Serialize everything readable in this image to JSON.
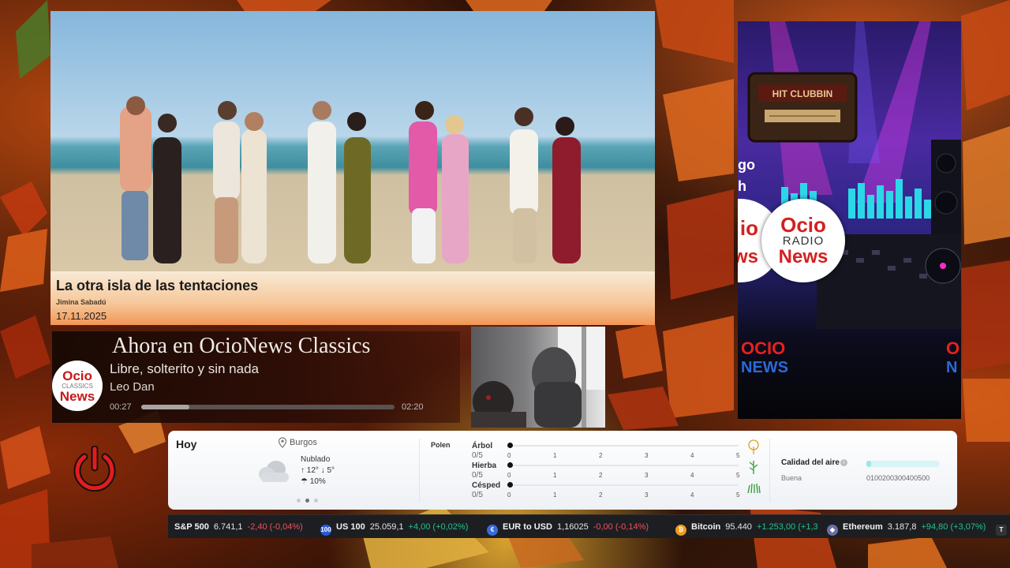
{
  "news": {
    "title": "La otra isla de las tentaciones",
    "author": "Jimina Sabadú",
    "date": "17.11.2025"
  },
  "radio": {
    "side_text_1": "go",
    "side_text_2": "h",
    "logo_top": "Ocio",
    "logo_mid": "RADIO",
    "logo_bottom": "News",
    "partial_logo_1": "io",
    "partial_logo_2": "ws",
    "badge_left_top": "OCIO",
    "badge_left_bottom": "NEWS",
    "badge_right_top": "O",
    "badge_right_bottom": "N"
  },
  "player": {
    "heading": "Ahora en OcioNews Classics",
    "logo_top": "Ocio",
    "logo_mid": "CLASSICS",
    "logo_bottom": "News",
    "song": "Libre, solterito y sin nada",
    "artist": "Leo Dan",
    "elapsed": "00:27",
    "total": "02:20",
    "progress": 0.19
  },
  "weather": {
    "today": "Hoy",
    "location": "Burgos",
    "condition": "Nublado",
    "temps": "↑ 12° ↓ 5°",
    "rain": "☂ 10%",
    "pollen_title": "Polen",
    "pollen": [
      {
        "name": "Árbol",
        "value": "0/5"
      },
      {
        "name": "Hierba",
        "value": "0/5"
      },
      {
        "name": "Césped",
        "value": "0/5"
      }
    ],
    "pollen_ticks": [
      "0",
      "1",
      "2",
      "3",
      "4",
      "5"
    ],
    "air_title": "Calidad del aire",
    "air_label": "Buena",
    "air_scale": "0100200300400500",
    "air_level": 0.06
  },
  "ticker": [
    {
      "name": "S&P 500",
      "price": "6.741,1",
      "change": "-2,40 (-0,04%)",
      "dir": "neg",
      "icon": ""
    },
    {
      "name": "US 100",
      "price": "25.059,1",
      "change": "+4,00 (+0,02%)",
      "dir": "pos",
      "icon": "100"
    },
    {
      "name": "EUR to USD",
      "price": "1,16025",
      "change": "-0,00 (-0,14%)",
      "dir": "neg",
      "icon": "€"
    },
    {
      "name": "Bitcoin",
      "price": "95.440",
      "change": "+1.253,00 (+1,3",
      "dir": "pos",
      "icon": "₿"
    },
    {
      "name": "Ethereum",
      "price": "3.187,8",
      "change": "+94,80 (+3,07%)",
      "dir": "pos",
      "icon": "◆"
    }
  ],
  "ticker_end_badge": "T",
  "colors": {
    "accent_red": "#d42020",
    "positive": "#22c38a",
    "negative": "#f0515a"
  }
}
